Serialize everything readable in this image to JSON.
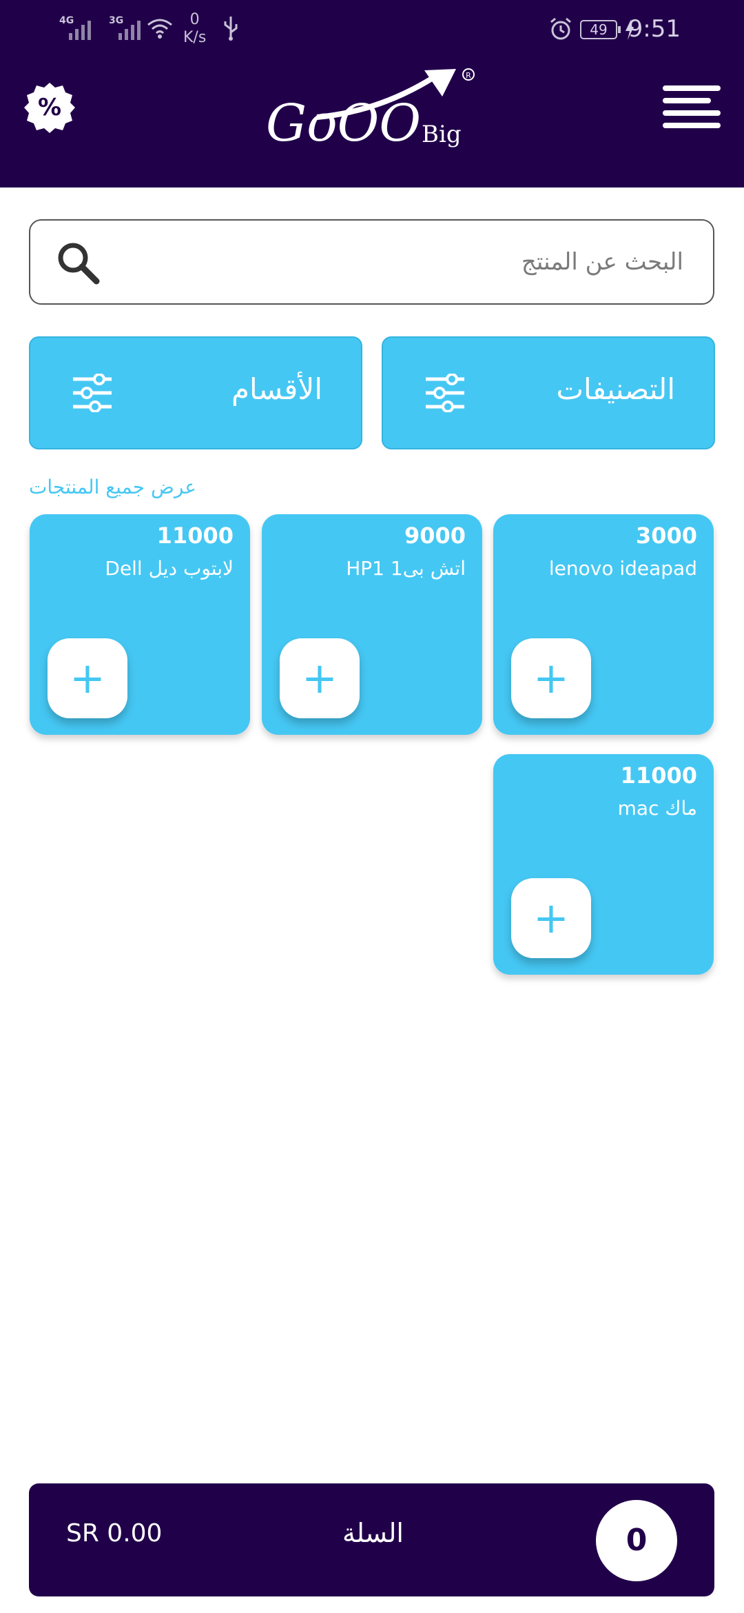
{
  "status_bar": {
    "network_1": "4G",
    "network_2": "3G",
    "speed_value": "0",
    "speed_unit": "K/s",
    "battery": "49",
    "time": "9:51"
  },
  "header": {
    "logo_text": "GoOO",
    "logo_sub": "Big",
    "background_color": "#21004a"
  },
  "search": {
    "placeholder": "البحث عن المنتج"
  },
  "filters": {
    "classifications_label": "التصنيفات",
    "sections_label": "الأقسام"
  },
  "view_all_label": "عرض جميع المنتجات",
  "products": [
    {
      "price": "3000",
      "name": "lenovo ideapad",
      "add_label": "+"
    },
    {
      "price": "9000",
      "name": "اتش بى1 HP1",
      "add_label": "+"
    },
    {
      "price": "11000",
      "name": "لابتوب ديل Dell",
      "add_label": "+"
    },
    {
      "price": "11000",
      "name": "ماك mac",
      "add_label": "+"
    }
  ],
  "cart": {
    "total": "SR 0.00",
    "title": "السلة",
    "count": "0"
  },
  "colors": {
    "accent": "#45c7f3",
    "dark": "#21004a"
  }
}
